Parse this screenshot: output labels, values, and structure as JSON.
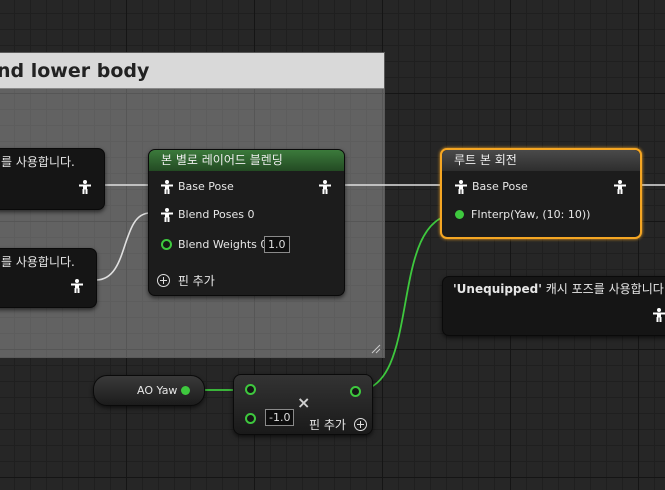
{
  "comment": {
    "title": "nd lower body"
  },
  "nodes": {
    "cache_top": {
      "label": "를 사용합니다."
    },
    "cache_mid": {
      "label": "를 사용합니다."
    },
    "layered_blend": {
      "title": "본 별로 레이어드 블렌딩",
      "base_pose": "Base Pose",
      "blend_poses": "Blend Poses 0",
      "blend_weights": "Blend Weights 0",
      "blend_weights_value": "1.0",
      "add_pin": "핀 추가"
    },
    "root_bone_rotate": {
      "title": "루트 본 회전",
      "base_pose": "Base Pose",
      "finterp": "FInterp(Yaw, (10: 10))"
    },
    "unequipped": {
      "quoted": "'Unequipped'",
      "label": " 캐시 포즈를 사용합니다."
    },
    "ao_yaw": {
      "label": "AO Yaw"
    },
    "multiply": {
      "value": "-1.0",
      "add_pin": "핀 추가",
      "op": "×"
    }
  },
  "colors": {
    "layered_header": "#2d5a2d",
    "root_header": "#3a3a3a",
    "selection_outline": "#f5a623",
    "float_pin": "#3ec83e"
  }
}
